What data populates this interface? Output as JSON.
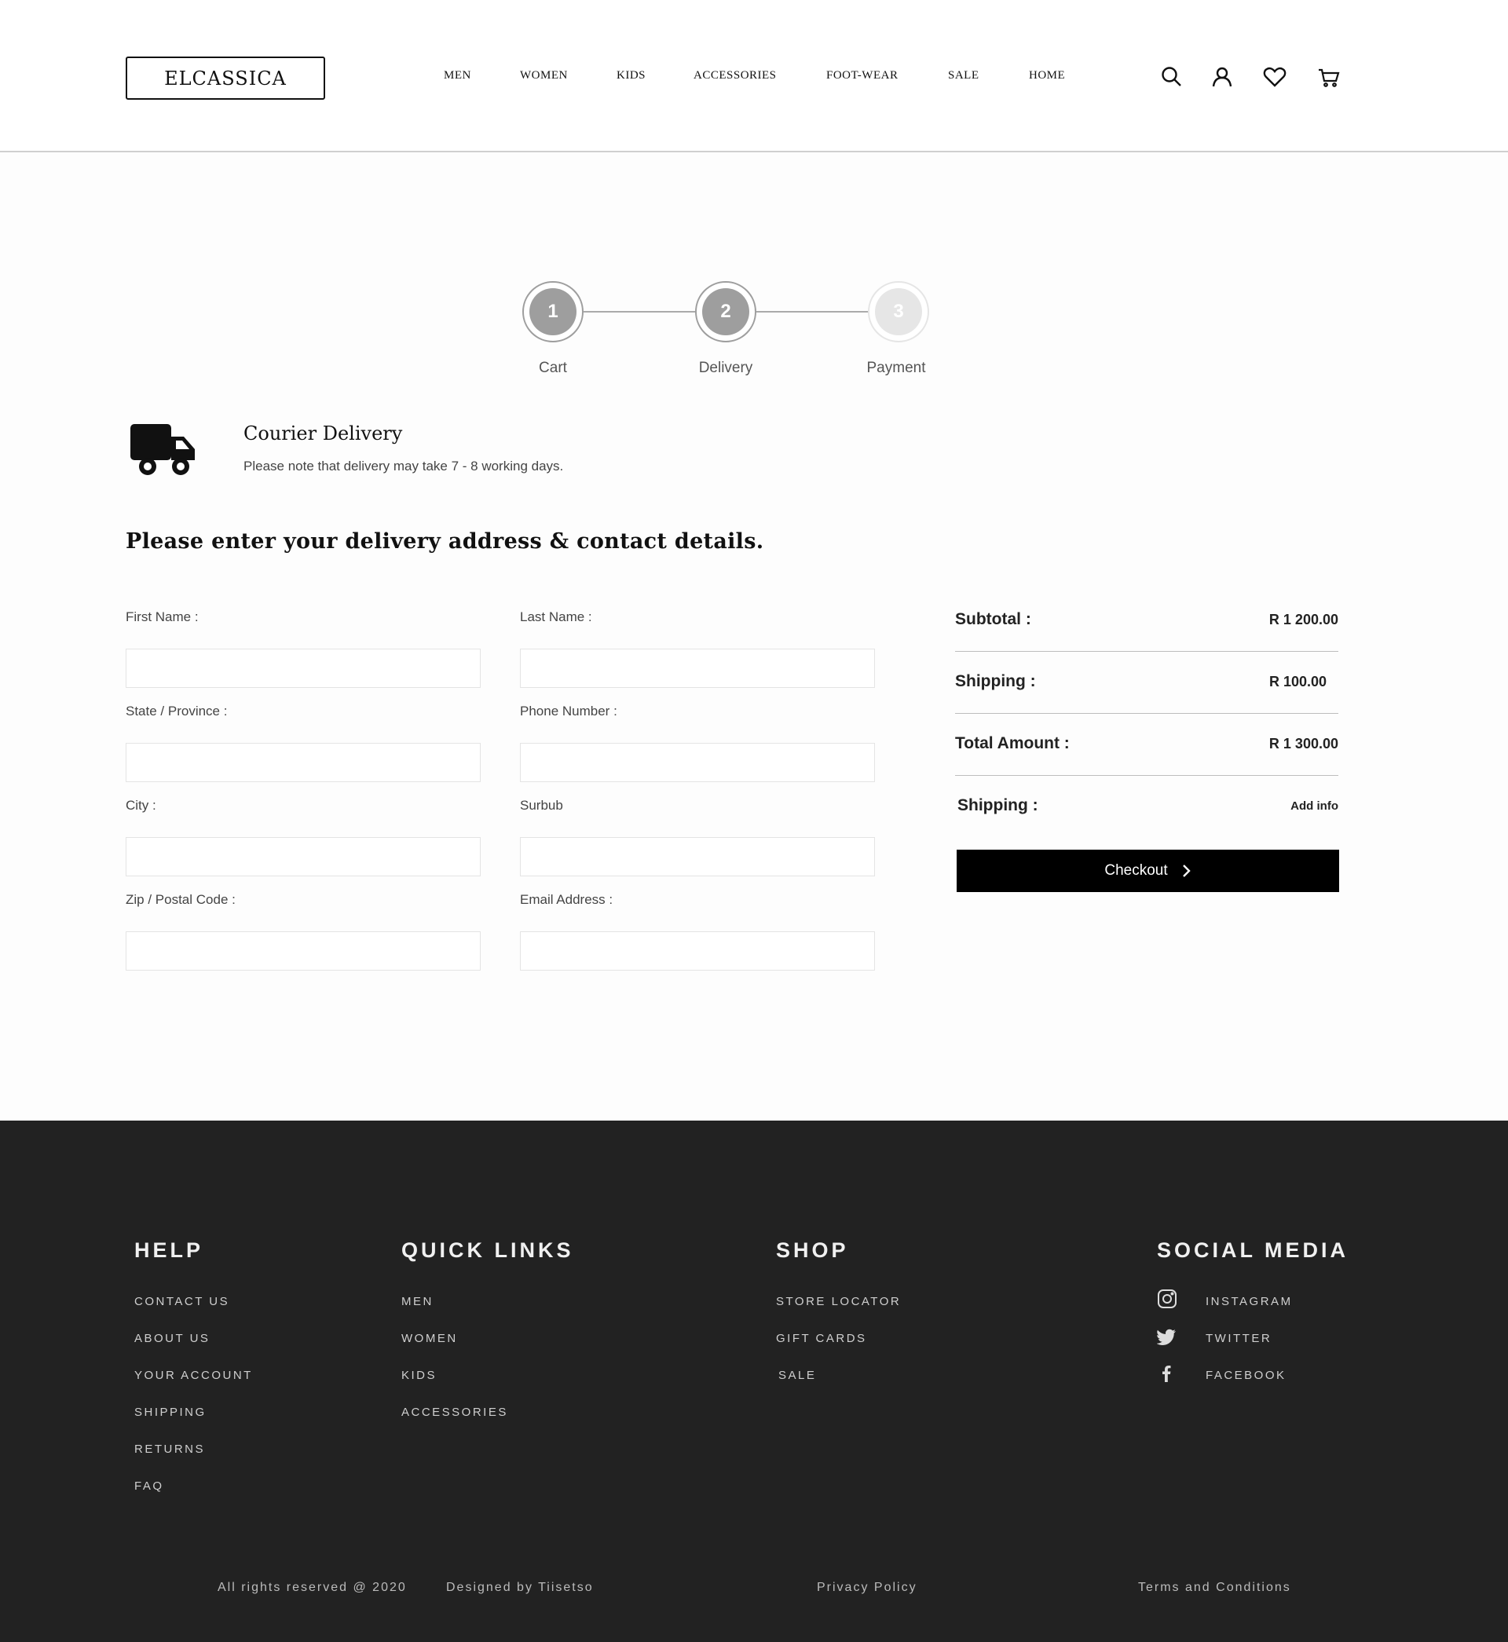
{
  "header": {
    "logo": "ELCASSICA",
    "nav": [
      "MEN",
      "WOMEN",
      "KIDS",
      "ACCESSORIES",
      "FOOT-WEAR",
      "SALE",
      "HOME"
    ],
    "icons": [
      "search-icon",
      "user-icon",
      "heart-icon",
      "cart-icon"
    ]
  },
  "stepper": {
    "steps": [
      {
        "number": "1",
        "label": "Cart",
        "state": "done"
      },
      {
        "number": "2",
        "label": "Delivery",
        "state": "current"
      },
      {
        "number": "3",
        "label": "Payment",
        "state": "inactive"
      }
    ]
  },
  "courier": {
    "title": "Courier Delivery",
    "note": "Please note that delivery may take 7 - 8 working days."
  },
  "form": {
    "heading": "Please enter your delivery address & contact details.",
    "fields": [
      {
        "label": "First Name :",
        "value": ""
      },
      {
        "label": "Last Name :",
        "value": ""
      },
      {
        "label": "State / Province :",
        "value": ""
      },
      {
        "label": "Phone Number :",
        "value": ""
      },
      {
        "label": "City :",
        "value": ""
      },
      {
        "label": "Surbub",
        "value": ""
      },
      {
        "label": "Zip / Postal Code :",
        "value": ""
      },
      {
        "label": "Email Address :",
        "value": ""
      }
    ]
  },
  "summary": {
    "subtotal_label": "Subtotal  :",
    "subtotal_value": "R 1 200.00",
    "shipping_label": "Shipping :",
    "shipping_value": "R 100.00",
    "total_label": "Total Amount :",
    "total_value": "R 1 300.00",
    "shipping_info_label": "Shipping :",
    "add_info": "Add info",
    "checkout": "Checkout"
  },
  "footer": {
    "help": {
      "heading": "HELP",
      "links": [
        "CONTACT US",
        "ABOUT US",
        "YOUR ACCOUNT",
        "SHIPPING",
        "RETURNS",
        "FAQ"
      ]
    },
    "quick_links": {
      "heading": "QUICK LINKS",
      "links": [
        "MEN",
        "WOMEN",
        "KIDS",
        "ACCESSORIES"
      ]
    },
    "shop": {
      "heading": "SHOP",
      "links": [
        "STORE LOCATOR",
        "GIFT CARDS",
        "SALE"
      ]
    },
    "social": {
      "heading": "SOCIAL MEDIA",
      "links": [
        "INSTAGRAM",
        "TWITTER",
        "FACEBOOK"
      ]
    },
    "rights": "All rights reserved @ 2020",
    "designed": "Designed by Tiisetso",
    "privacy": "Privacy Policy",
    "terms": "Terms and Conditions"
  },
  "colors": {
    "accent": "#000000",
    "footer_bg": "#222222",
    "step_active": "#9e9e9e",
    "step_inactive": "#e6e6e6"
  }
}
